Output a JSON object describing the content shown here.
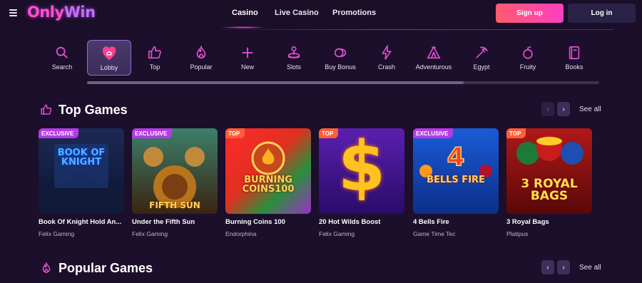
{
  "brand": {
    "logo_part1": "Only",
    "logo_part2": "Win"
  },
  "header": {
    "nav": [
      "Casino",
      "Live Casino",
      "Promotions"
    ],
    "signup_label": "Sign up",
    "login_label": "Log in"
  },
  "categories": [
    {
      "label": "Search",
      "icon": "search-icon"
    },
    {
      "label": "Lobby",
      "icon": "lobby-icon"
    },
    {
      "label": "Top",
      "icon": "thumbs-up-icon"
    },
    {
      "label": "Popular",
      "icon": "flame-icon"
    },
    {
      "label": "New",
      "icon": "plus-icon"
    },
    {
      "label": "Slots",
      "icon": "joystick-icon"
    },
    {
      "label": "Buy Bonus",
      "icon": "coins-icon"
    },
    {
      "label": "Crash",
      "icon": "lightning-icon"
    },
    {
      "label": "Adventurous",
      "icon": "tent-icon"
    },
    {
      "label": "Egypt",
      "icon": "pickaxe-icon"
    },
    {
      "label": "Fruity",
      "icon": "fruit-icon"
    },
    {
      "label": "Books",
      "icon": "book-icon"
    }
  ],
  "colors": {
    "accent": "#ff4fd8",
    "background": "#1b0f2b",
    "exclusive": "#b43be6",
    "top": "#ff5e3a"
  },
  "top_games": {
    "title": "Top Games",
    "see_all": "See all",
    "prev_arrow": "‹",
    "next_arrow": "›",
    "games": [
      {
        "badge": "EXCLUSIVE",
        "title": "Book Of Knight Hold An...",
        "provider": "Felix Gaming",
        "art_text": "BOOK OF KNIGHT"
      },
      {
        "badge": "EXCLUSIVE",
        "title": "Under the Fifth Sun",
        "provider": "Felix Gaming",
        "art_text": "FIFTH SUN"
      },
      {
        "badge": "TOP",
        "title": "Burning Coins 100",
        "provider": "Endorphina",
        "art_text": "BURNING COINS100"
      },
      {
        "badge": "TOP",
        "title": "20 Hot Wilds Boost",
        "provider": "Felix Gaming",
        "art_text": "$"
      },
      {
        "badge": "EXCLUSIVE",
        "title": "4 Bells Fire",
        "provider": "Game Time Tec",
        "art_text": "BELLS FIRE"
      },
      {
        "badge": "TOP",
        "title": "3 Royal Bags",
        "provider": "Platipus",
        "art_text": "3 ROYAL BAGS"
      }
    ]
  },
  "popular_games": {
    "title": "Popular Games",
    "see_all": "See all",
    "prev_arrow": "‹",
    "next_arrow": "›"
  }
}
